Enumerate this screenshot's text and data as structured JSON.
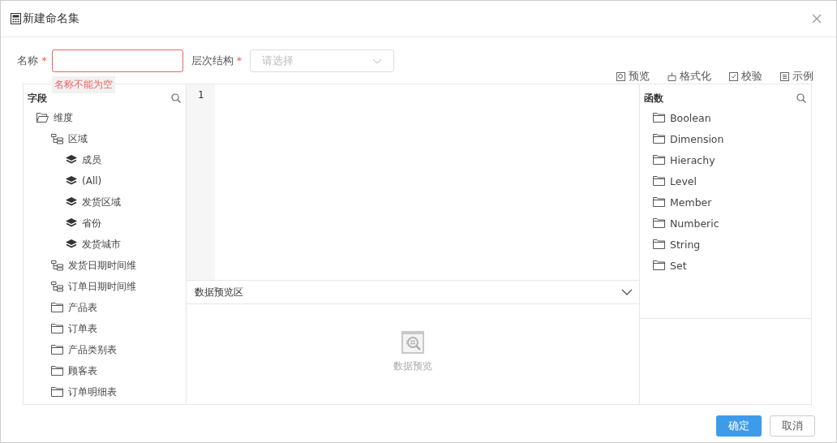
{
  "dialog": {
    "title": "新建命名集"
  },
  "name_field": {
    "label": "名称",
    "required_mark": "*",
    "error": "名称不能为空"
  },
  "hierarchy_field": {
    "label": "层次结构",
    "required_mark": "*",
    "placeholder": "请选择"
  },
  "toolbar": [
    {
      "kind": "preview",
      "label": "预览"
    },
    {
      "kind": "format",
      "label": "格式化"
    },
    {
      "kind": "validate",
      "label": "校验"
    },
    {
      "kind": "example",
      "label": "示例"
    }
  ],
  "fields_panel": {
    "title": "字段",
    "tree": [
      {
        "label": "维度",
        "kind": "folder",
        "expanded": true,
        "children": [
          {
            "label": "区域",
            "kind": "hierarchy",
            "children": [
              {
                "label": "成员",
                "kind": "level"
              },
              {
                "label": "(All)",
                "kind": "level"
              },
              {
                "label": "发货区域",
                "kind": "level"
              },
              {
                "label": "省份",
                "kind": "level"
              },
              {
                "label": "发货城市",
                "kind": "level"
              }
            ]
          },
          {
            "label": "发货日期时间维",
            "kind": "hierarchy"
          },
          {
            "label": "订单日期时间维",
            "kind": "hierarchy"
          },
          {
            "label": "产品表",
            "kind": "folder",
            "expanded": false
          },
          {
            "label": "订单表",
            "kind": "folder",
            "expanded": false
          },
          {
            "label": "产品类别表",
            "kind": "folder",
            "expanded": false
          },
          {
            "label": "顾客表",
            "kind": "folder",
            "expanded": false
          },
          {
            "label": "订单明细表",
            "kind": "folder",
            "expanded": false
          }
        ]
      }
    ]
  },
  "editor": {
    "line_numbers": [
      "1"
    ]
  },
  "preview": {
    "title": "数据预览区",
    "expanded": true,
    "empty_text": "数据预览"
  },
  "functions_panel": {
    "title": "函数",
    "items": [
      "Boolean",
      "Dimension",
      "Hierachy",
      "Level",
      "Member",
      "Numberic",
      "String",
      "Set"
    ]
  },
  "buttons": [
    {
      "kind": "primary",
      "label": "确定"
    },
    {
      "kind": "default",
      "label": "取消"
    }
  ]
}
